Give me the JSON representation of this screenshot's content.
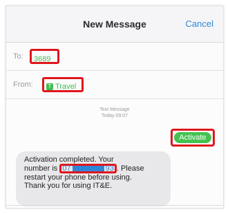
{
  "header": {
    "title": "New Message",
    "cancel_label": "Cancel"
  },
  "to": {
    "label": "To:",
    "value": "3689"
  },
  "from": {
    "label": "From:",
    "sim_badge": "T",
    "value": "Travel"
  },
  "thread": {
    "meta_line1": "Text Message",
    "meta_line2": "Today 09:07"
  },
  "sent_message": "Activate",
  "received_message": {
    "line1": "Activation completed. Your",
    "line2_before": "number is",
    "number_start": "07",
    "number_end": "93",
    "line2_after": ". Please",
    "line3": "restart your phone before using.",
    "line4": "Thank you for using IT&E."
  },
  "colors": {
    "accent_green": "#44c251",
    "link_blue": "#2f86d8",
    "highlight_red": "#e0151b"
  }
}
